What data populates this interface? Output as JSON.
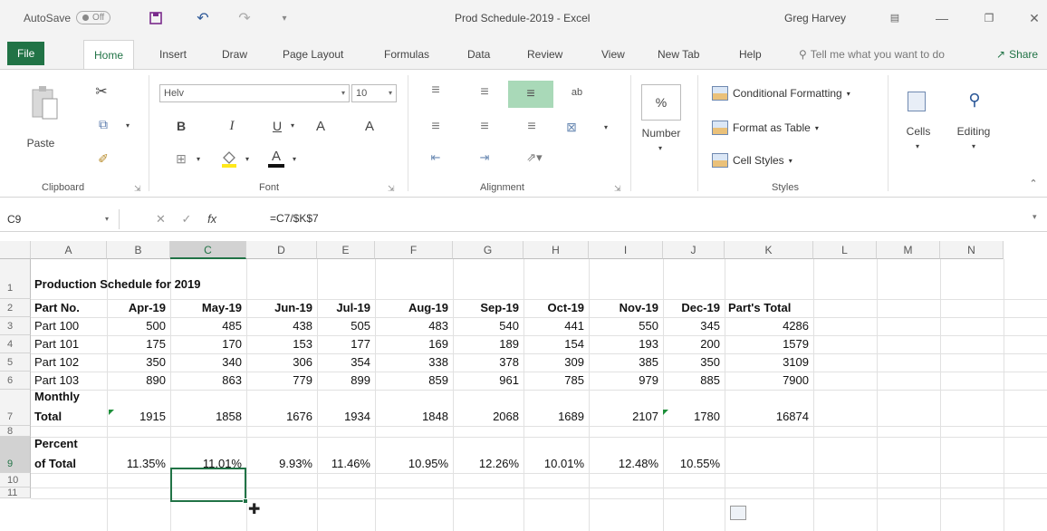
{
  "titlebar": {
    "autosave_label": "AutoSave",
    "autosave_state": "Off",
    "document_title": "Prod Schedule-2019  -  Excel",
    "user_name": "Greg Harvey"
  },
  "tabs": {
    "file": "File",
    "items": [
      "Home",
      "Insert",
      "Draw",
      "Page Layout",
      "Formulas",
      "Data",
      "Review",
      "View",
      "New Tab",
      "Help"
    ],
    "tell_me": "Tell me what you want to do",
    "share": "Share"
  },
  "ribbon": {
    "clipboard": {
      "paste": "Paste",
      "label": "Clipboard"
    },
    "font": {
      "name": "Helv",
      "size": "10",
      "bold": "B",
      "italic": "I",
      "underline": "U",
      "grow": "A",
      "shrink": "A",
      "font_color": "A",
      "label": "Font"
    },
    "alignment": {
      "label": "Alignment"
    },
    "number": {
      "label": "Number"
    },
    "styles": {
      "conditional": "Conditional Formatting",
      "format_table": "Format as Table",
      "cell_styles": "Cell Styles",
      "label": "Styles"
    },
    "cells": "Cells",
    "editing": "Editing"
  },
  "formula_bar": {
    "name_box": "C9",
    "fx": "fx",
    "formula": "=C7/$K$7"
  },
  "grid": {
    "columns": [
      "A",
      "B",
      "C",
      "D",
      "E",
      "F",
      "G",
      "H",
      "I",
      "J",
      "K",
      "L",
      "M",
      "N"
    ],
    "rows": [
      "1",
      "2",
      "3",
      "4",
      "5",
      "6",
      "7",
      "8",
      "9",
      "10",
      "11"
    ],
    "title": "Production Schedule for 2019",
    "header": [
      "Part No.",
      "Apr-19",
      "May-19",
      "Jun-19",
      "Jul-19",
      "Aug-19",
      "Sep-19",
      "Oct-19",
      "Nov-19",
      "Dec-19",
      "Part's Total"
    ],
    "parts": [
      [
        "Part 100",
        "500",
        "485",
        "438",
        "505",
        "483",
        "540",
        "441",
        "550",
        "345",
        "4286"
      ],
      [
        "Part 101",
        "175",
        "170",
        "153",
        "177",
        "169",
        "189",
        "154",
        "193",
        "200",
        "1579"
      ],
      [
        "Part 102",
        "350",
        "340",
        "306",
        "354",
        "338",
        "378",
        "309",
        "385",
        "350",
        "3109"
      ],
      [
        "Part 103",
        "890",
        "863",
        "779",
        "899",
        "859",
        "961",
        "785",
        "979",
        "885",
        "7900"
      ]
    ],
    "monthly_label_1": "Monthly",
    "monthly_label_2": "Total",
    "monthly": [
      "1915",
      "1858",
      "1676",
      "1934",
      "1848",
      "2068",
      "1689",
      "2107",
      "1780",
      "16874"
    ],
    "percent_label_1": "Percent",
    "percent_label_2": "of Total",
    "percent": [
      "11.35%",
      "11.01%",
      "9.93%",
      "11.46%",
      "10.95%",
      "12.26%",
      "10.01%",
      "12.48%",
      "10.55%"
    ]
  }
}
